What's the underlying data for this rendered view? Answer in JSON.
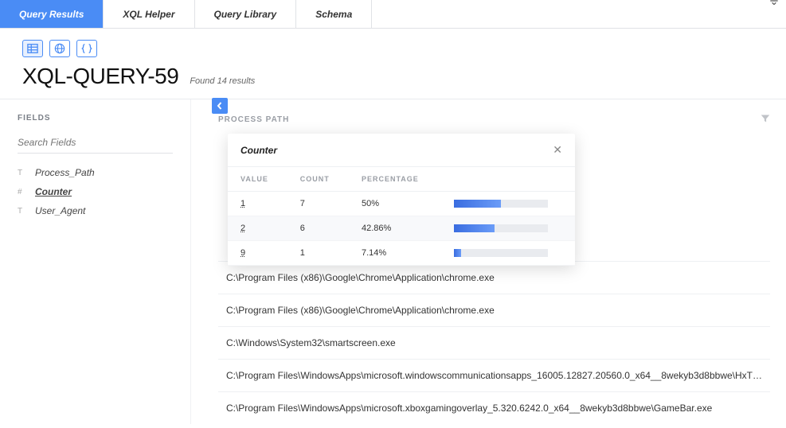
{
  "tabs": [
    "Query Results",
    "XQL Helper",
    "Query Library",
    "Schema"
  ],
  "activeTab": 0,
  "viewmodes": [
    "table",
    "globe",
    "json"
  ],
  "query_title": "XQL-QUERY-59",
  "result_summary": "Found 14 results",
  "sidebar": {
    "heading": "FIELDS",
    "search_placeholder": "Search Fields",
    "fields": [
      {
        "type": "T",
        "name": "Process_Path",
        "selected": false
      },
      {
        "type": "#",
        "name": "Counter",
        "selected": true
      },
      {
        "type": "T",
        "name": "User_Agent",
        "selected": false
      }
    ]
  },
  "column_header": "PROCESS PATH",
  "rows": [
    "C:\\Program Files (x86)\\Google\\Chrome\\Application\\chrome.exe",
    "C:\\Program Files (x86)\\Google\\Chrome\\Application\\chrome.exe",
    "C:\\Windows\\System32\\smartscreen.exe",
    "C:\\Program Files\\WindowsApps\\microsoft.windowscommunicationsapps_16005.12827.20560.0_x64__8wekyb3d8bbwe\\HxT…",
    "C:\\Program Files\\WindowsApps\\microsoft.xboxgamingoverlay_5.320.6242.0_x64__8wekyb3d8bbwe\\GameBar.exe"
  ],
  "popover": {
    "title": "Counter",
    "headers": [
      "VALUE",
      "COUNT",
      "PERCENTAGE",
      ""
    ],
    "rows": [
      {
        "value": "1",
        "count": "7",
        "percentage": "50%",
        "bar": 50
      },
      {
        "value": "2",
        "count": "6",
        "percentage": "42.86%",
        "bar": 42.86
      },
      {
        "value": "9",
        "count": "1",
        "percentage": "7.14%",
        "bar": 7.14
      }
    ]
  }
}
